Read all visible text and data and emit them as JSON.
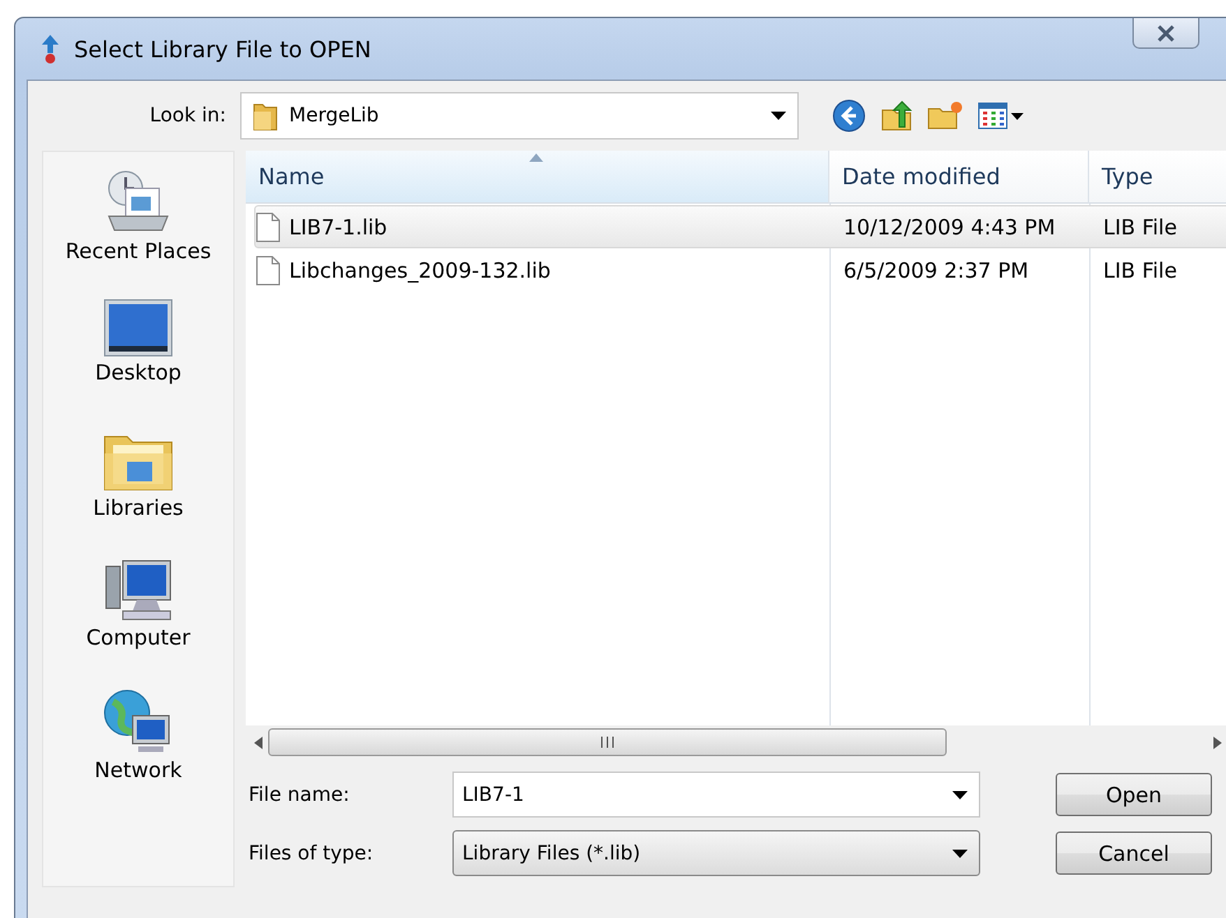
{
  "window": {
    "title": "Select Library File to OPEN"
  },
  "look_in": {
    "label": "Look in:",
    "value": "MergeLib"
  },
  "sidebar": {
    "items": [
      {
        "label": "Recent Places",
        "kind": "recent"
      },
      {
        "label": "Desktop",
        "kind": "desktop"
      },
      {
        "label": "Libraries",
        "kind": "libraries"
      },
      {
        "label": "Computer",
        "kind": "computer"
      },
      {
        "label": "Network",
        "kind": "network"
      }
    ]
  },
  "table": {
    "columns": [
      "Name",
      "Date modified",
      "Type"
    ],
    "rows": [
      {
        "name": "LIB7-1.lib",
        "date": "10/12/2009 4:43 PM",
        "type": "LIB File",
        "selected": true
      },
      {
        "name": "Libchanges_2009-132.lib",
        "date": "6/5/2009 2:37 PM",
        "type": "LIB File",
        "selected": false
      }
    ]
  },
  "file_name": {
    "label": "File name:",
    "value": "LIB7-1"
  },
  "file_type": {
    "label": "Files of type:",
    "value": "Library Files (*.lib)"
  },
  "buttons": [
    "Open",
    "Cancel"
  ]
}
